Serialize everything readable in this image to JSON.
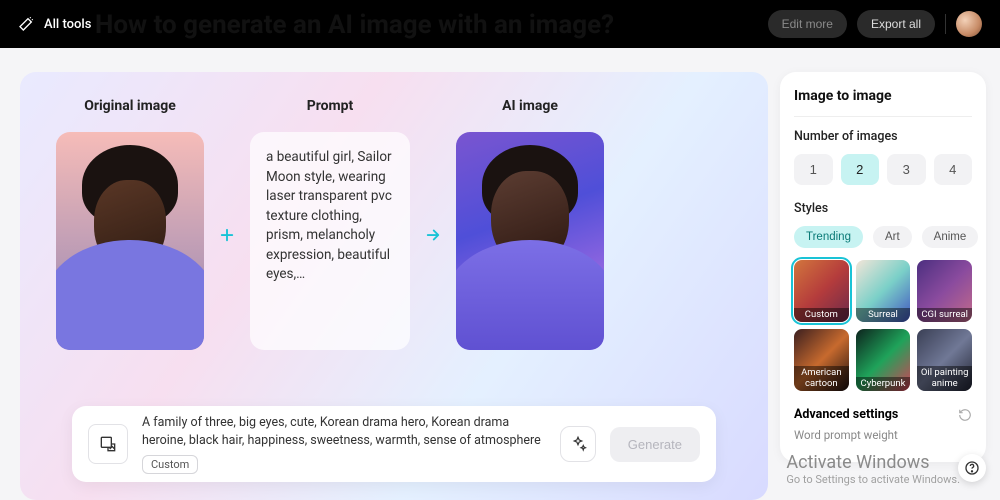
{
  "topbar": {
    "all_tools": "All tools",
    "edit_more": "Edit more",
    "export_all": "Export all"
  },
  "heading_fragment": "How to generate an AI image with an image?",
  "comparison": {
    "original_label": "Original image",
    "prompt_label": "Prompt",
    "ai_label": "AI image",
    "prompt_text": "a beautiful girl, Sailor Moon style, wearing laser transparent pvc texture clothing, prism, melancholy expression, beautiful eyes,…"
  },
  "generate_bar": {
    "prompt": "A family of three, big eyes, cute, Korean drama hero, Korean drama heroine, black hair, happiness, sweetness, warmth, sense of atmosphere",
    "chip": "Custom",
    "button": "Generate"
  },
  "sidebar": {
    "title": "Image to image",
    "num_label": "Number of images",
    "num_options": [
      "1",
      "2",
      "3",
      "4"
    ],
    "num_selected": "2",
    "styles_label": "Styles",
    "style_tabs": [
      "Trending",
      "Art",
      "Anime"
    ],
    "style_tab_selected": "Trending",
    "styles": [
      {
        "name": "Custom",
        "selected": true
      },
      {
        "name": "Surreal",
        "selected": false
      },
      {
        "name": "CGI surreal",
        "selected": false
      },
      {
        "name": "American cartoon",
        "selected": false
      },
      {
        "name": "Cyberpunk",
        "selected": false
      },
      {
        "name": "Oil painting anime",
        "selected": false
      }
    ],
    "advanced_label": "Advanced settings",
    "advanced_sub": "Word prompt weight"
  },
  "watermark": {
    "line1": "Activate Windows",
    "line2": "Go to Settings to activate Windows."
  }
}
